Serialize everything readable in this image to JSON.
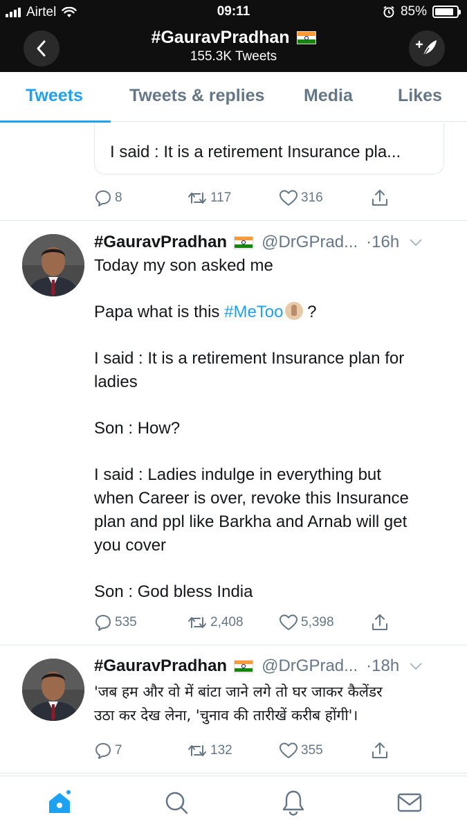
{
  "status_bar": {
    "carrier": "Airtel",
    "time": "09:11",
    "battery": "85%",
    "battery_level": 0.85
  },
  "header": {
    "title": "#GauravPradhan",
    "tweet_count": "155.3K Tweets",
    "back_icon": "chevron-left-icon",
    "compose_icon": "compose-tweet-icon"
  },
  "tabs": [
    {
      "label": "Tweets",
      "active": true
    },
    {
      "label": "Tweets & replies",
      "active": false
    },
    {
      "label": "Media",
      "active": false
    },
    {
      "label": "Likes",
      "active": false
    }
  ],
  "feed": {
    "partial_tweet": {
      "quote_text": "I said : It is a retirement Insurance pla...",
      "replies": "8",
      "retweets": "117",
      "likes": "316"
    },
    "tweets": [
      {
        "name": "#GauravPradhan",
        "handle": "@DrGPrad...",
        "time": "·16h",
        "lines": [
          "Today my son asked me",
          "",
          "Papa what is this ",
          "",
          "I said : It is a retirement Insurance plan for",
          "ladies",
          "",
          "Son : How?",
          "",
          "I said : Ladies indulge in everything but",
          "when Career is over, revoke this Insurance",
          "plan and ppl like Barkha and Arnab will get",
          "you cover",
          "",
          "Son : God bless India"
        ],
        "hashtag": "#MeToo",
        "after_hashtag": " ?",
        "replies": "535",
        "retweets": "2,408",
        "likes": "5,398"
      },
      {
        "name": "#GauravPradhan",
        "handle": "@DrGPrad...",
        "time": "·18h",
        "line1": "'जब हम और वो में बांटा जाने लगे तो घर जाकर कैलेंडर",
        "line2": "उठा कर देख लेना, 'चुनाव की तारीखें करीब होंगी'।",
        "replies": "7",
        "retweets": "132",
        "likes": "355"
      }
    ]
  },
  "bottom_nav": [
    "home-icon",
    "search-icon",
    "notifications-icon",
    "messages-icon"
  ],
  "colors": {
    "accent": "#1da1f2",
    "secondary_text": "#657786",
    "header_bg": "#0f0f0f"
  }
}
